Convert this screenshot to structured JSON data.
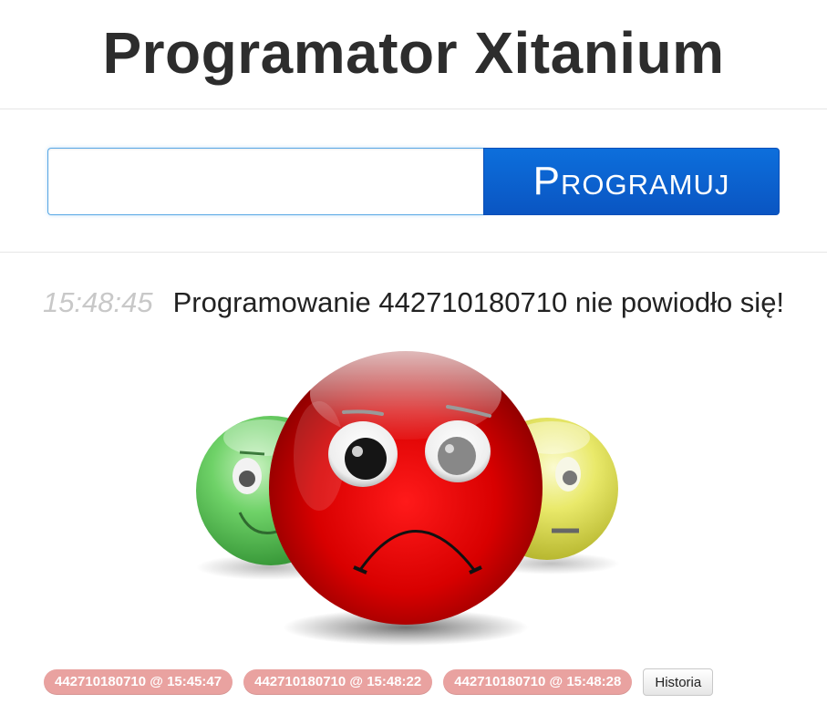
{
  "header": {
    "title": "Programator Xitanium"
  },
  "form": {
    "input_value": "",
    "input_placeholder": "",
    "button_label": "Programuj"
  },
  "status": {
    "time": "15:48:45",
    "message": "Programowanie 442710180710 nie powiodło się!",
    "result": "failure",
    "image": "sad-red-smiley-with-green-and-yellow-smileys"
  },
  "history": {
    "entries": [
      "442710180710 @ 15:45:47",
      "442710180710 @ 15:48:22",
      "442710180710 @ 15:48:28"
    ],
    "button_label": "Historia"
  },
  "colors": {
    "button_blue": "#0a5fcf",
    "badge_red": "#e9a2a0",
    "time_gray": "#c8c8c8",
    "smiley_red": "#e40000",
    "smiley_green": "#5fc95f",
    "smiley_yellow": "#e8e866"
  }
}
